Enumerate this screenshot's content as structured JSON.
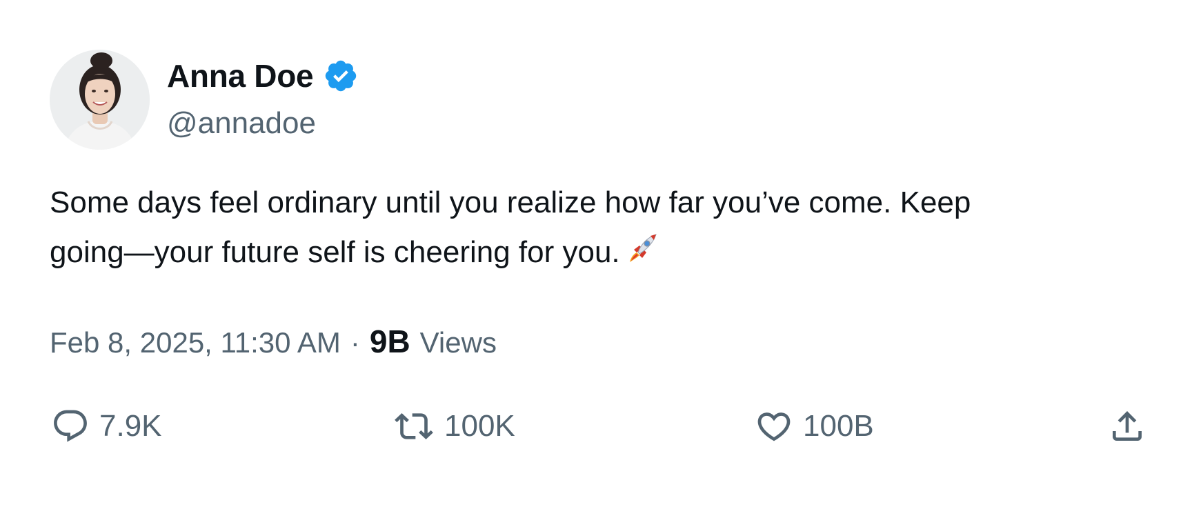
{
  "author": {
    "name": "Anna Doe",
    "handle": "@annadoe",
    "verified": true,
    "verified_color": "#1d9bf0",
    "avatar_icon": "profile-photo"
  },
  "post": {
    "text_lines": [
      "Some days feel ordinary until you realize how far you’ve come. Keep",
      "going—your future self is cheering for you."
    ],
    "emoji": "rocket-emoji"
  },
  "meta": {
    "timestamp": "Feb 8, 2025, 11:30 AM",
    "separator": "·",
    "views_count": "9B",
    "views_label": "Views"
  },
  "actions": {
    "reply": {
      "icon": "reply-icon",
      "count": "7.9K"
    },
    "repost": {
      "icon": "repost-icon",
      "count": "100K"
    },
    "like": {
      "icon": "heart-icon",
      "count": "100B"
    },
    "share": {
      "icon": "share-icon"
    }
  },
  "colors": {
    "text_primary": "#0f1419",
    "text_secondary": "#536471",
    "verified_blue": "#1d9bf0"
  }
}
